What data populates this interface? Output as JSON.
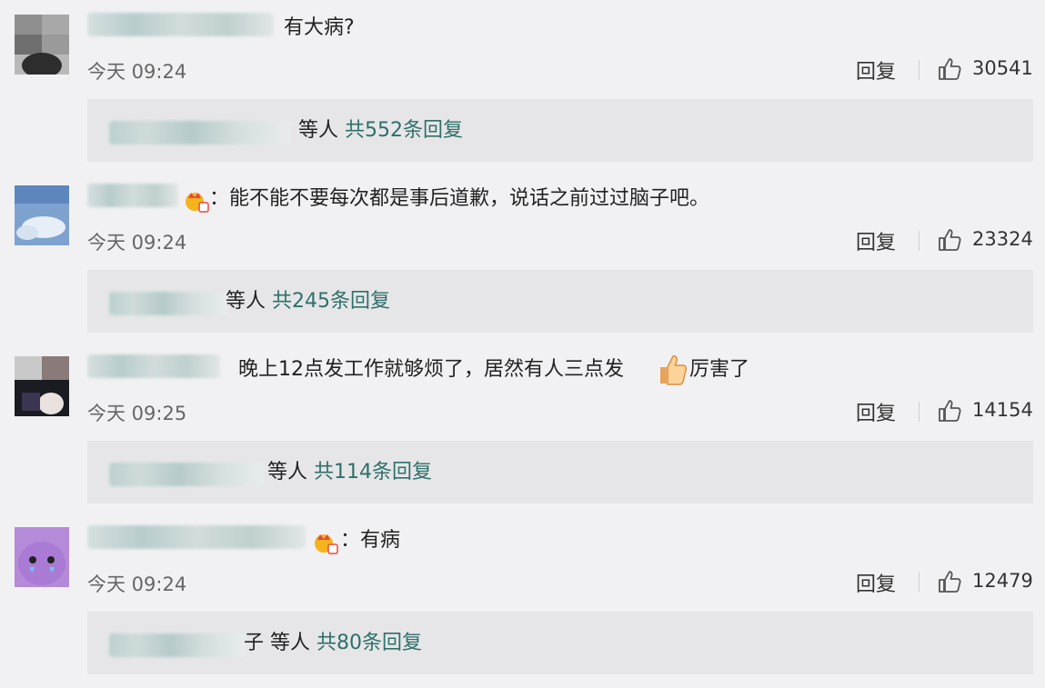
{
  "ui": {
    "reply_label": "回复"
  },
  "comments": [
    {
      "text": "有大病?",
      "time": "今天 09:24",
      "likes": "30541",
      "reply_tail": "等人",
      "reply_count": "共552条回复"
    },
    {
      "text": "：能不能不要每次都是事后道歉，说话之前过过脑子吧。",
      "time": "今天 09:24",
      "likes": "23324",
      "reply_tail": "等人",
      "reply_count": "共245条回复"
    },
    {
      "text": "晚上12点发工作就够烦了，居然有人三点发",
      "text_after": "厉害了",
      "time": "今天 09:25",
      "likes": "14154",
      "reply_tail": "等人",
      "reply_count": "共114条回复"
    },
    {
      "text": "：有病",
      "time": "今天 09:24",
      "likes": "12479",
      "reply_tail": "子 等人",
      "reply_count": "共80条回复"
    }
  ],
  "colors": {
    "accent": "#2f7068",
    "background": "#f1f1f3",
    "reply_box": "#e6e6e9"
  },
  "icons": {
    "like": "thumbs-up-outline-icon",
    "badge": "crown-member-badge-icon",
    "emoji": "thumbs-up-emoji-icon"
  }
}
